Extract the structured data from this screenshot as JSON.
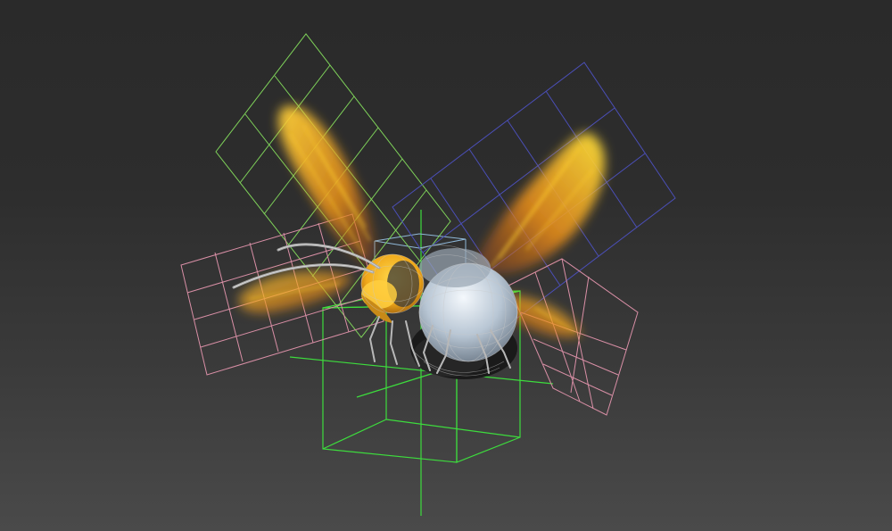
{
  "viewport": {
    "background_top": "#2a2a2a",
    "background_bottom": "#4a4a4a"
  },
  "gizmo_colors": {
    "upper_left_wing_plane": "#7fd35a",
    "upper_right_wing_plane": "#4b4fb8",
    "lower_wing_planes": "#d98fa6",
    "body_box": "#3ddc3d",
    "head_box": "#8fb8d8",
    "axis_lines": "#3ddc3d",
    "wireframe": "#b8b8b8"
  },
  "model": {
    "head_color": "#f2b81c",
    "wing_color": "#f2a21c",
    "thorax_color": "#cfd8e0",
    "abdomen_color": "#1a1a1a",
    "eye_color": "#3a3a3a"
  }
}
